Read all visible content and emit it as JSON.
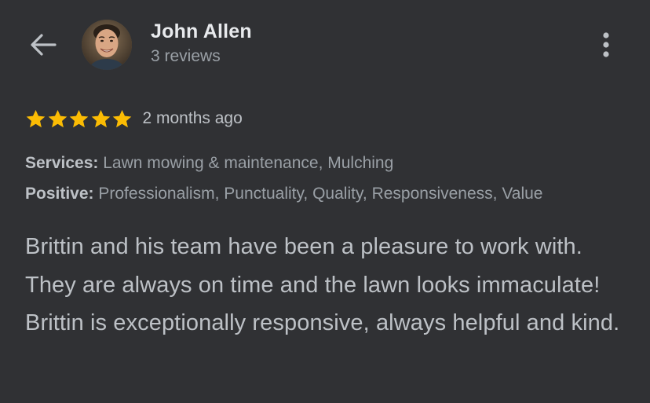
{
  "header": {
    "back_icon": "arrow-left-icon",
    "reviewer_name": "John Allen",
    "reviewer_subtitle": "3 reviews",
    "more_icon": "more-vertical-icon"
  },
  "review": {
    "rating": 5,
    "rating_max": 5,
    "star_color": "#fbbc04",
    "time_ago": "2 months ago",
    "services_label": "Services:",
    "services_value": "Lawn mowing & maintenance, Mulching",
    "positive_label": "Positive:",
    "positive_value": "Professionalism, Punctuality, Quality, Responsiveness, Value",
    "text": "Brittin and his team have been a pleasure to work with. They are always on time and the lawn looks immaculate! Brittin is exceptionally responsive, always helpful and kind."
  },
  "colors": {
    "background": "#303134",
    "primary_text": "#e8eaed",
    "secondary_text": "#9aa0a6"
  }
}
